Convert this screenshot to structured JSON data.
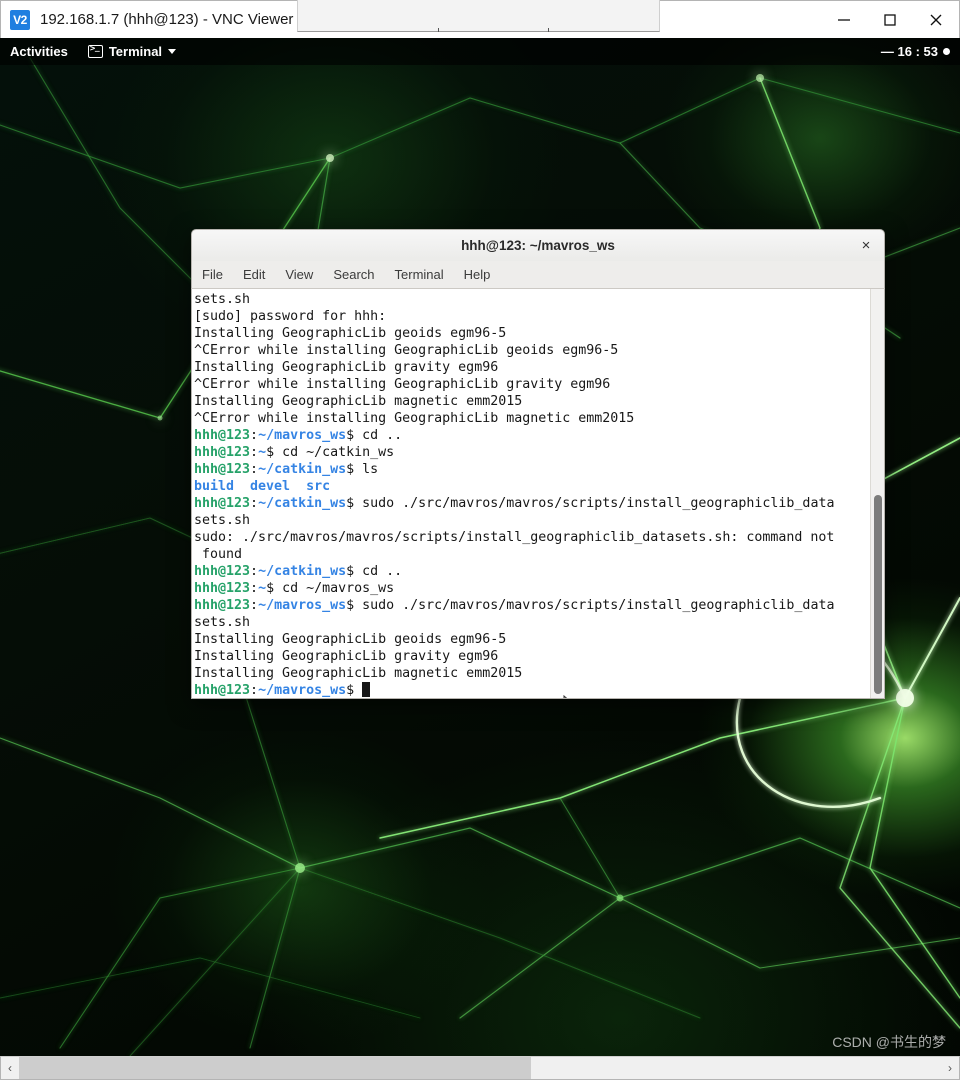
{
  "vnc_window": {
    "logo_label": "V2",
    "title": "192.168.1.7 (hhh@123) - VNC Viewer",
    "minimize_label": "Minimize",
    "maximize_label": "Maximize",
    "close_label": "Close"
  },
  "gnome_topbar": {
    "activities": "Activities",
    "app_name": "Terminal",
    "clock": "— 16 : 53"
  },
  "terminal": {
    "title": "hhh@123: ~/mavros_ws",
    "close_label": "×",
    "menu": [
      "File",
      "Edit",
      "View",
      "Search",
      "Terminal",
      "Help"
    ],
    "colors": {
      "user": "#26a269",
      "path": "#3584e4",
      "text": "#171717",
      "background": "#ffffff"
    },
    "lines": [
      {
        "segments": [
          {
            "text": "sets.sh",
            "style": "plain"
          }
        ]
      },
      {
        "segments": [
          {
            "text": "[sudo] password for hhh:",
            "style": "plain"
          }
        ]
      },
      {
        "segments": [
          {
            "text": "Installing GeographicLib geoids egm96-5",
            "style": "plain"
          }
        ]
      },
      {
        "segments": [
          {
            "text": "^CError while installing GeographicLib geoids egm96-5",
            "style": "plain"
          }
        ]
      },
      {
        "segments": [
          {
            "text": "Installing GeographicLib gravity egm96",
            "style": "plain"
          }
        ]
      },
      {
        "segments": [
          {
            "text": "^CError while installing GeographicLib gravity egm96",
            "style": "plain"
          }
        ]
      },
      {
        "segments": [
          {
            "text": "Installing GeographicLib magnetic emm2015",
            "style": "plain"
          }
        ]
      },
      {
        "segments": [
          {
            "text": "^CError while installing GeographicLib magnetic emm2015",
            "style": "plain"
          }
        ]
      },
      {
        "segments": [
          {
            "text": "hhh@123",
            "style": "user"
          },
          {
            "text": ":",
            "style": "plain"
          },
          {
            "text": "~/mavros_ws",
            "style": "path"
          },
          {
            "text": "$ cd ..",
            "style": "plain"
          }
        ]
      },
      {
        "segments": [
          {
            "text": "hhh@123",
            "style": "user"
          },
          {
            "text": ":",
            "style": "plain"
          },
          {
            "text": "~",
            "style": "path"
          },
          {
            "text": "$ cd ~/catkin_ws",
            "style": "plain"
          }
        ]
      },
      {
        "segments": [
          {
            "text": "hhh@123",
            "style": "user"
          },
          {
            "text": ":",
            "style": "plain"
          },
          {
            "text": "~/catkin_ws",
            "style": "path"
          },
          {
            "text": "$ ls",
            "style": "plain"
          }
        ]
      },
      {
        "segments": [
          {
            "text": "build  devel  src",
            "style": "dir"
          }
        ]
      },
      {
        "segments": [
          {
            "text": "hhh@123",
            "style": "user"
          },
          {
            "text": ":",
            "style": "plain"
          },
          {
            "text": "~/catkin_ws",
            "style": "path"
          },
          {
            "text": "$ sudo ./src/mavros/mavros/scripts/install_geographiclib_data",
            "style": "plain"
          }
        ]
      },
      {
        "segments": [
          {
            "text": "sets.sh",
            "style": "plain"
          }
        ]
      },
      {
        "segments": [
          {
            "text": "sudo: ./src/mavros/mavros/scripts/install_geographiclib_datasets.sh: command not",
            "style": "plain"
          }
        ]
      },
      {
        "segments": [
          {
            "text": " found",
            "style": "plain"
          }
        ]
      },
      {
        "segments": [
          {
            "text": "hhh@123",
            "style": "user"
          },
          {
            "text": ":",
            "style": "plain"
          },
          {
            "text": "~/catkin_ws",
            "style": "path"
          },
          {
            "text": "$ cd ..",
            "style": "plain"
          }
        ]
      },
      {
        "segments": [
          {
            "text": "hhh@123",
            "style": "user"
          },
          {
            "text": ":",
            "style": "plain"
          },
          {
            "text": "~",
            "style": "path"
          },
          {
            "text": "$ cd ~/mavros_ws",
            "style": "plain"
          }
        ]
      },
      {
        "segments": [
          {
            "text": "hhh@123",
            "style": "user"
          },
          {
            "text": ":",
            "style": "plain"
          },
          {
            "text": "~/mavros_ws",
            "style": "path"
          },
          {
            "text": "$ sudo ./src/mavros/mavros/scripts/install_geographiclib_data",
            "style": "plain"
          }
        ]
      },
      {
        "segments": [
          {
            "text": "sets.sh",
            "style": "plain"
          }
        ]
      },
      {
        "segments": [
          {
            "text": "Installing GeographicLib geoids egm96-5",
            "style": "plain"
          }
        ]
      },
      {
        "segments": [
          {
            "text": "Installing GeographicLib gravity egm96",
            "style": "plain"
          }
        ]
      },
      {
        "segments": [
          {
            "text": "Installing GeographicLib magnetic emm2015",
            "style": "plain"
          }
        ]
      },
      {
        "segments": [
          {
            "text": "hhh@123",
            "style": "user"
          },
          {
            "text": ":",
            "style": "plain"
          },
          {
            "text": "~/mavros_ws",
            "style": "path"
          },
          {
            "text": "$ ",
            "style": "plain"
          },
          {
            "text": "",
            "style": "cursor"
          }
        ]
      }
    ]
  },
  "host_scrollbar": {
    "left_arrow": "‹",
    "right_arrow": "›"
  },
  "watermark": "CSDN @书生的梦"
}
